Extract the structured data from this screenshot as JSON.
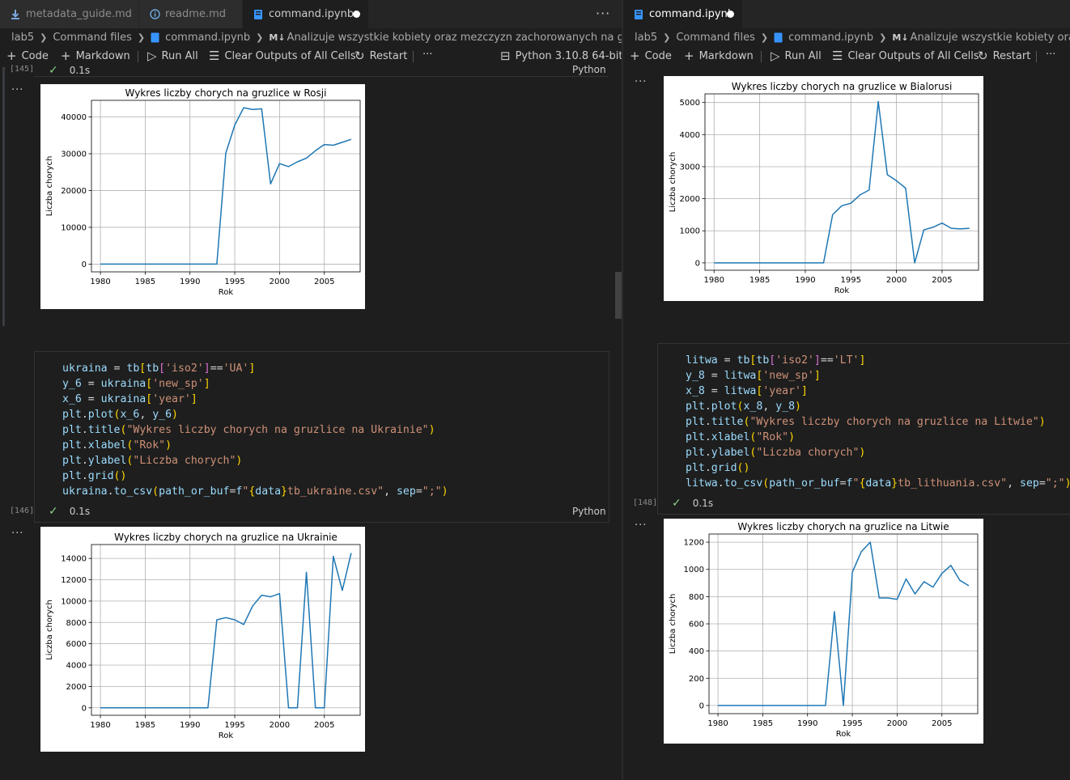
{
  "colors": {
    "background": "#1e1e1e",
    "line": "#1f77b4",
    "check": "#89d185"
  },
  "left": {
    "tabs": [
      {
        "label": "metadata_guide.md",
        "icon": "download-icon"
      },
      {
        "label": "readme.md",
        "icon": "info-icon"
      },
      {
        "label": "command.ipynb",
        "icon": "notebook-icon"
      }
    ],
    "breadcrumb": [
      "lab5",
      "Command files",
      "command.ipynb",
      "Analizuje wszystkie kobiety oraz mezczyzn zachorowanych na gruzlice zamieszkal"
    ],
    "breadcrumb_md": "M↓",
    "toolbar": {
      "code": "Code",
      "markdown": "Markdown",
      "run_all": "Run All",
      "clear": "Clear Outputs of All Cells",
      "restart": "Restart",
      "kernel": "Python 3.10.8 64-bit",
      "more": "···"
    },
    "cell1": {
      "count": "[145]",
      "time": "0.1s",
      "lang": "Python"
    },
    "cell2": {
      "count": "[146]",
      "time": "0.1s",
      "lang": "Python"
    }
  },
  "right": {
    "tab": "command.ipynb",
    "breadcrumb": [
      "lab5",
      "Command files",
      "command.ipynb",
      "Analizuje wszystkie kobiety oraz mezczyzn z"
    ],
    "breadcrumb_md": "M↓",
    "toolbar": {
      "code": "Code",
      "markdown": "Markdown",
      "run_all": "Run All",
      "clear": "Clear Outputs of All Cells",
      "restart": "Restart",
      "more": "···"
    },
    "cell1": {
      "count": "[148]",
      "time": "0.1s"
    }
  },
  "output_dots": "···",
  "code_ukraina": [
    [
      [
        "v",
        "ukraina"
      ],
      [
        "d",
        " = "
      ],
      [
        "v",
        "tb"
      ],
      [
        "p",
        "["
      ],
      [
        "v",
        "tb"
      ],
      [
        "pp",
        "["
      ],
      [
        "s",
        "'iso2'"
      ],
      [
        "pp",
        "]"
      ],
      [
        "d",
        "=="
      ],
      [
        "s",
        "'UA'"
      ],
      [
        "p",
        "]"
      ]
    ],
    [
      [
        "v",
        "y_6"
      ],
      [
        "d",
        " = "
      ],
      [
        "v",
        "ukraina"
      ],
      [
        "p",
        "["
      ],
      [
        "s",
        "'new_sp'"
      ],
      [
        "p",
        "]"
      ]
    ],
    [
      [
        "v",
        "x_6"
      ],
      [
        "d",
        " = "
      ],
      [
        "v",
        "ukraina"
      ],
      [
        "p",
        "["
      ],
      [
        "s",
        "'year'"
      ],
      [
        "p",
        "]"
      ]
    ],
    [
      [
        "v",
        "plt"
      ],
      [
        "d",
        "."
      ],
      [
        "v",
        "plot"
      ],
      [
        "p",
        "("
      ],
      [
        "v",
        "x_6"
      ],
      [
        "d",
        ", "
      ],
      [
        "v",
        "y_6"
      ],
      [
        "p",
        ")"
      ]
    ],
    [
      [
        "v",
        "plt"
      ],
      [
        "d",
        "."
      ],
      [
        "v",
        "title"
      ],
      [
        "p",
        "("
      ],
      [
        "s",
        "\"Wykres liczby chorych na gruzlice na Ukrainie\""
      ],
      [
        "p",
        ")"
      ]
    ],
    [
      [
        "v",
        "plt"
      ],
      [
        "d",
        "."
      ],
      [
        "v",
        "xlabel"
      ],
      [
        "p",
        "("
      ],
      [
        "s",
        "\"Rok\""
      ],
      [
        "p",
        ")"
      ]
    ],
    [
      [
        "v",
        "plt"
      ],
      [
        "d",
        "."
      ],
      [
        "v",
        "ylabel"
      ],
      [
        "p",
        "("
      ],
      [
        "s",
        "\"Liczba chorych\""
      ],
      [
        "p",
        ")"
      ]
    ],
    [
      [
        "v",
        "plt"
      ],
      [
        "d",
        "."
      ],
      [
        "v",
        "grid"
      ],
      [
        "p",
        "()"
      ]
    ],
    [
      [
        "v",
        "ukraina"
      ],
      [
        "d",
        "."
      ],
      [
        "v",
        "to_csv"
      ],
      [
        "p",
        "("
      ],
      [
        "v",
        "path_or_buf"
      ],
      [
        "d",
        "="
      ],
      [
        "v",
        "f"
      ],
      [
        "s",
        "\""
      ],
      [
        "p",
        "{"
      ],
      [
        "v",
        "data"
      ],
      [
        "p",
        "}"
      ],
      [
        "s",
        "tb_ukraine.csv\""
      ],
      [
        "d",
        ", "
      ],
      [
        "v",
        "sep"
      ],
      [
        "d",
        "="
      ],
      [
        "s",
        "\";\""
      ],
      [
        "p",
        ")"
      ]
    ]
  ],
  "code_litwa": [
    [
      [
        "v",
        "litwa"
      ],
      [
        "d",
        " = "
      ],
      [
        "v",
        "tb"
      ],
      [
        "p",
        "["
      ],
      [
        "v",
        "tb"
      ],
      [
        "pp",
        "["
      ],
      [
        "s",
        "'iso2'"
      ],
      [
        "pp",
        "]"
      ],
      [
        "d",
        "=="
      ],
      [
        "s",
        "'LT'"
      ],
      [
        "p",
        "]"
      ]
    ],
    [
      [
        "v",
        "y_8"
      ],
      [
        "d",
        " = "
      ],
      [
        "v",
        "litwa"
      ],
      [
        "p",
        "["
      ],
      [
        "s",
        "'new_sp'"
      ],
      [
        "p",
        "]"
      ]
    ],
    [
      [
        "v",
        "x_8"
      ],
      [
        "d",
        " = "
      ],
      [
        "v",
        "litwa"
      ],
      [
        "p",
        "["
      ],
      [
        "s",
        "'year'"
      ],
      [
        "p",
        "]"
      ]
    ],
    [
      [
        "v",
        "plt"
      ],
      [
        "d",
        "."
      ],
      [
        "v",
        "plot"
      ],
      [
        "p",
        "("
      ],
      [
        "v",
        "x_8"
      ],
      [
        "d",
        ", "
      ],
      [
        "v",
        "y_8"
      ],
      [
        "p",
        ")"
      ]
    ],
    [
      [
        "v",
        "plt"
      ],
      [
        "d",
        "."
      ],
      [
        "v",
        "title"
      ],
      [
        "p",
        "("
      ],
      [
        "s",
        "\"Wykres liczby chorych na gruzlice na Litwie\""
      ],
      [
        "p",
        ")"
      ]
    ],
    [
      [
        "v",
        "plt"
      ],
      [
        "d",
        "."
      ],
      [
        "v",
        "xlabel"
      ],
      [
        "p",
        "("
      ],
      [
        "s",
        "\"Rok\""
      ],
      [
        "p",
        ")"
      ]
    ],
    [
      [
        "v",
        "plt"
      ],
      [
        "d",
        "."
      ],
      [
        "v",
        "ylabel"
      ],
      [
        "p",
        "("
      ],
      [
        "s",
        "\"Liczba chorych\""
      ],
      [
        "p",
        ")"
      ]
    ],
    [
      [
        "v",
        "plt"
      ],
      [
        "d",
        "."
      ],
      [
        "v",
        "grid"
      ],
      [
        "p",
        "()"
      ]
    ],
    [
      [
        "v",
        "litwa"
      ],
      [
        "d",
        "."
      ],
      [
        "v",
        "to_csv"
      ],
      [
        "p",
        "("
      ],
      [
        "v",
        "path_or_buf"
      ],
      [
        "d",
        "="
      ],
      [
        "v",
        "f"
      ],
      [
        "s",
        "\""
      ],
      [
        "p",
        "{"
      ],
      [
        "v",
        "data"
      ],
      [
        "p",
        "}"
      ],
      [
        "s",
        "tb_lithuania.csv\""
      ],
      [
        "d",
        ", "
      ],
      [
        "v",
        "sep"
      ],
      [
        "d",
        "="
      ],
      [
        "s",
        "\";\""
      ],
      [
        "p",
        ")"
      ]
    ]
  ],
  "chart_data": [
    {
      "type": "line",
      "title": "Wykres liczby chorych na gruzlice w Rosji",
      "xlabel": "Rok",
      "ylabel": "Liczba chorych",
      "xlim": [
        1979,
        2009
      ],
      "ylim": [
        -2100,
        44500
      ],
      "xticks": [
        1980,
        1985,
        1990,
        1995,
        2000,
        2005
      ],
      "yticks": [
        0,
        10000,
        20000,
        30000,
        40000
      ],
      "grid": true,
      "x": [
        1980,
        1981,
        1982,
        1983,
        1984,
        1985,
        1986,
        1987,
        1988,
        1989,
        1990,
        1991,
        1992,
        1993,
        1994,
        1995,
        1996,
        1997,
        1998,
        1999,
        2000,
        2001,
        2002,
        2003,
        2004,
        2005,
        2006,
        2007,
        2008
      ],
      "y": [
        0,
        0,
        0,
        0,
        0,
        0,
        0,
        0,
        0,
        0,
        0,
        0,
        0,
        0,
        30200,
        37800,
        42500,
        42000,
        42200,
        21800,
        27300,
        26500,
        27800,
        28800,
        30800,
        32500,
        32300,
        33100,
        33900
      ]
    },
    {
      "type": "line",
      "title": "Wykres liczby chorych na gruzlice na Ukrainie",
      "xlabel": "Rok",
      "ylabel": "Liczba chorych",
      "xlim": [
        1979,
        2009
      ],
      "ylim": [
        -700,
        15300
      ],
      "xticks": [
        1980,
        1985,
        1990,
        1995,
        2000,
        2005
      ],
      "yticks": [
        0,
        2000,
        4000,
        6000,
        8000,
        10000,
        12000,
        14000
      ],
      "grid": true,
      "x": [
        1980,
        1981,
        1982,
        1983,
        1984,
        1985,
        1986,
        1987,
        1988,
        1989,
        1990,
        1991,
        1992,
        1993,
        1994,
        1995,
        1996,
        1997,
        1998,
        1999,
        2000,
        2001,
        2002,
        2003,
        2004,
        2005,
        2006,
        2007,
        2008
      ],
      "y": [
        0,
        0,
        0,
        0,
        0,
        0,
        0,
        0,
        0,
        0,
        0,
        0,
        0,
        8250,
        8450,
        8250,
        7800,
        9550,
        10550,
        10400,
        10700,
        0,
        0,
        12700,
        0,
        0,
        14200,
        11000,
        14500
      ]
    },
    {
      "type": "line",
      "title": "Wykres liczby chorych na gruzlice w Bialorusi",
      "xlabel": "Rok",
      "ylabel": "Liczba chorych",
      "xlim": [
        1979,
        2009
      ],
      "ylim": [
        -230,
        5270
      ],
      "xticks": [
        1980,
        1985,
        1990,
        1995,
        2000,
        2005
      ],
      "yticks": [
        0,
        1000,
        2000,
        3000,
        4000,
        5000
      ],
      "grid": true,
      "x": [
        1980,
        1981,
        1982,
        1983,
        1984,
        1985,
        1986,
        1987,
        1988,
        1989,
        1990,
        1991,
        1992,
        1993,
        1994,
        1995,
        1996,
        1997,
        1998,
        1999,
        2000,
        2001,
        2002,
        2003,
        2004,
        2005,
        2006,
        2007,
        2008
      ],
      "y": [
        0,
        0,
        0,
        0,
        0,
        0,
        0,
        0,
        0,
        0,
        0,
        0,
        0,
        1500,
        1780,
        1860,
        2120,
        2270,
        5030,
        2750,
        2560,
        2330,
        0,
        1030,
        1110,
        1240,
        1080,
        1060,
        1080
      ]
    },
    {
      "type": "line",
      "title": "Wykres liczby chorych na gruzlice na Litwie",
      "xlabel": "Rok",
      "ylabel": "Liczba chorych",
      "xlim": [
        1979,
        2009
      ],
      "ylim": [
        -60,
        1260
      ],
      "xticks": [
        1980,
        1985,
        1990,
        1995,
        2000,
        2005
      ],
      "yticks": [
        0,
        200,
        400,
        600,
        800,
        1000,
        1200
      ],
      "grid": true,
      "x": [
        1980,
        1981,
        1982,
        1983,
        1984,
        1985,
        1986,
        1987,
        1988,
        1989,
        1990,
        1991,
        1992,
        1993,
        1994,
        1995,
        1996,
        1997,
        1998,
        1999,
        2000,
        2001,
        2002,
        2003,
        2004,
        2005,
        2006,
        2007,
        2008
      ],
      "y": [
        0,
        0,
        0,
        0,
        0,
        0,
        0,
        0,
        0,
        0,
        0,
        0,
        0,
        690,
        0,
        980,
        1130,
        1200,
        790,
        790,
        780,
        930,
        820,
        910,
        870,
        970,
        1030,
        920,
        880
      ]
    }
  ]
}
